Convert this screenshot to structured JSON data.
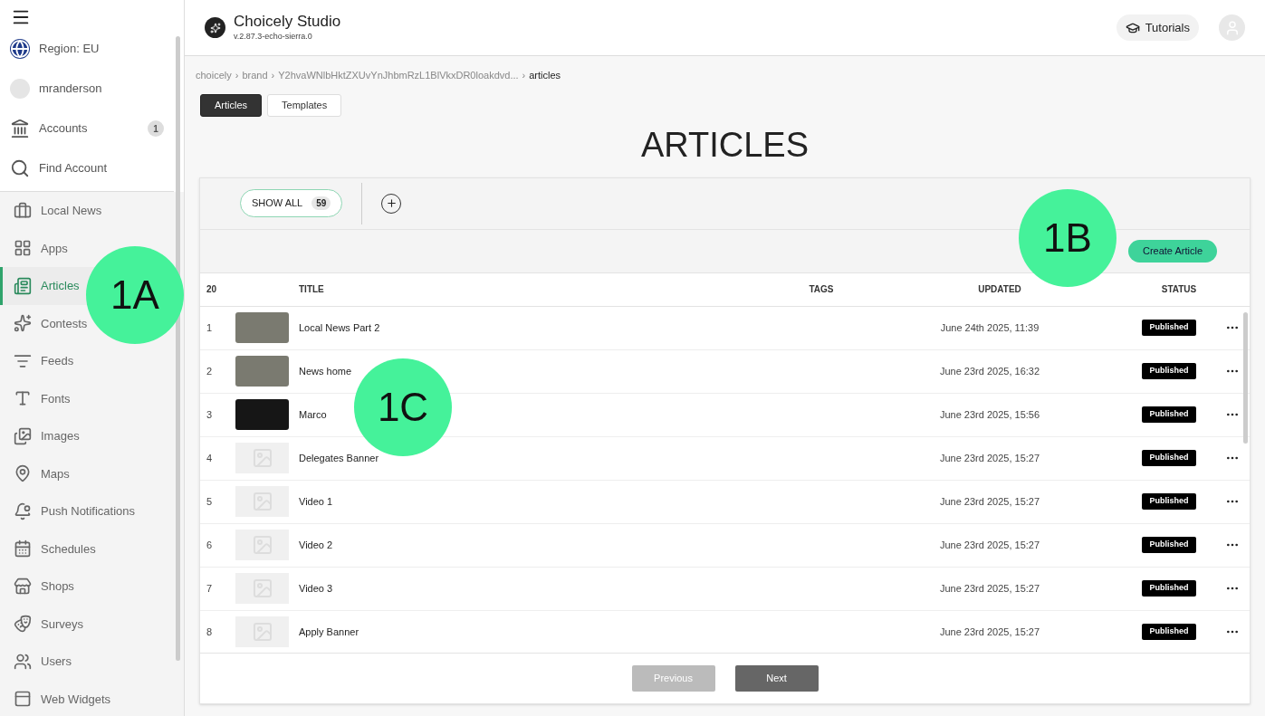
{
  "sidebar": {
    "top_items": [
      {
        "kind": "region",
        "label": "Region: EU"
      },
      {
        "kind": "user",
        "label": "mranderson"
      },
      {
        "kind": "accounts",
        "label": "Accounts",
        "badge": "1"
      },
      {
        "kind": "search",
        "label": "Find Account"
      }
    ],
    "items": [
      {
        "label": "Local News",
        "selected": false
      },
      {
        "label": "Apps",
        "selected": false
      },
      {
        "label": "Articles",
        "selected": true
      },
      {
        "label": "Contests",
        "selected": false
      },
      {
        "label": "Feeds",
        "selected": false
      },
      {
        "label": "Fonts",
        "selected": false
      },
      {
        "label": "Images",
        "selected": false
      },
      {
        "label": "Maps",
        "selected": false
      },
      {
        "label": "Push Notifications",
        "selected": false
      },
      {
        "label": "Schedules",
        "selected": false
      },
      {
        "label": "Shops",
        "selected": false
      },
      {
        "label": "Surveys",
        "selected": false
      },
      {
        "label": "Users",
        "selected": false
      },
      {
        "label": "Web Widgets",
        "selected": false
      }
    ]
  },
  "header": {
    "title": "Choicely Studio",
    "version": "v.2.87.3-echo-sierra.0",
    "tutorials": "Tutorials"
  },
  "breadcrumb": [
    {
      "label": "choicely"
    },
    {
      "separator": "›",
      "label": "brand"
    },
    {
      "separator": "›",
      "label": "Y2hvaWNlbHktZXUvYnJhbmRzL1BlVkxDR0loakdvd..."
    },
    {
      "separator": "›",
      "label": "articles"
    }
  ],
  "tabs": [
    {
      "label": "Articles",
      "selected": true
    },
    {
      "label": "Templates",
      "selected": false
    }
  ],
  "page_title": "ARTICLES",
  "filter": {
    "label": "SHOW ALL",
    "count": "59"
  },
  "create_button": "Create Article",
  "table": {
    "columns": [
      "20",
      "TITLE",
      "TAGS",
      "UPDATED",
      "STATUS"
    ],
    "rows": [
      {
        "index": "1",
        "kind": "photo",
        "title": "Local News Part 2",
        "updated": "June 24th 2025, 11:39",
        "status": "Published"
      },
      {
        "index": "2",
        "kind": "photo",
        "title": "News home",
        "updated": "June 23rd 2025, 16:32",
        "status": "Published"
      },
      {
        "index": "3",
        "kind": "dark",
        "title": "Marco",
        "updated": "June 23rd 2025, 15:56",
        "status": "Published"
      },
      {
        "index": "4",
        "kind": "placeholder",
        "title": "Delegates Banner",
        "updated": "June 23rd 2025, 15:27",
        "status": "Published"
      },
      {
        "index": "5",
        "kind": "placeholder",
        "title": "Video 1",
        "updated": "June 23rd 2025, 15:27",
        "status": "Published"
      },
      {
        "index": "6",
        "kind": "placeholder",
        "title": "Video 2",
        "updated": "June 23rd 2025, 15:27",
        "status": "Published"
      },
      {
        "index": "7",
        "kind": "placeholder",
        "title": "Video 3",
        "updated": "June 23rd 2025, 15:27",
        "status": "Published"
      },
      {
        "index": "8",
        "kind": "placeholder",
        "title": "Apply Banner",
        "updated": "June 23rd 2025, 15:27",
        "status": "Published"
      }
    ]
  },
  "pagination": {
    "previous": {
      "label": "Previous",
      "disabled": true
    },
    "next": {
      "label": "Next",
      "disabled": false
    }
  },
  "callouts": [
    "1A",
    "1B",
    "1C"
  ]
}
